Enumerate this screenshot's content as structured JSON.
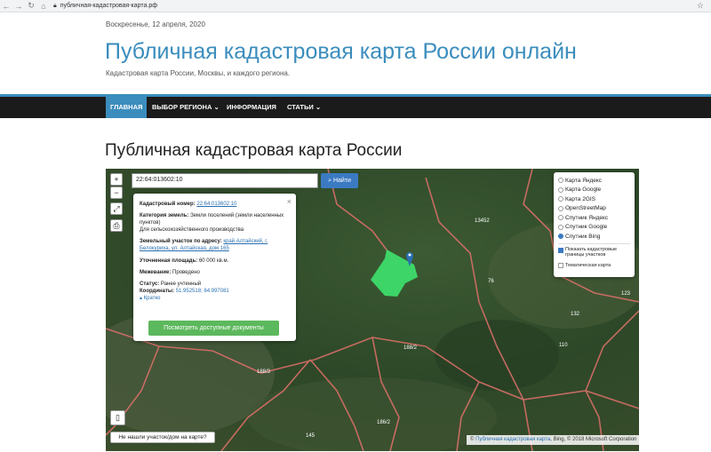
{
  "browser": {
    "url": "публичная-кадастровая-карта.рф"
  },
  "header": {
    "date": "Воскресенье, 12 апреля, 2020",
    "site_title": "Публичная кадастровая карта России онлайн",
    "site_desc": "Кадастровая карта России, Москвы, и каждого региона."
  },
  "nav": {
    "home": "ГЛАВНАЯ",
    "region": "ВЫБОР РЕГИОНА",
    "info": "ИНФОРМАЦИЯ",
    "articles": "СТАТЬИ"
  },
  "page": {
    "title": "Публичная кадастровая карта России"
  },
  "map": {
    "search_value": "22:64:013602:10",
    "find_label": "Найти",
    "popup": {
      "cad_label": "Кадастровый номер:",
      "cad_value": "22:64:013602:10",
      "cat_label": "Категория земель:",
      "cat_value": "Земли поселений (земли населенных пунктов)",
      "cat_extra": "Для сельскохозяйственного производства",
      "addr_label": "Земельный участок по адресу:",
      "addr_value": "край Алтайский, г. Белокуриха, ул. Алтайская, дом 165",
      "area_label": "Уточненная площадь:",
      "area_value": "60 000 кв.м.",
      "mezh_label": "Межевание:",
      "mezh_value": "Проведено",
      "status_label": "Статус:",
      "status_value": "Ранее учтенный",
      "coord_label": "Координаты:",
      "coord_value": "51.952518; 84.997081",
      "brief": "Кратко",
      "docs_button": "Посмотреть доступные документы"
    },
    "layers": [
      {
        "label": "Карта Яндекс",
        "selected": false
      },
      {
        "label": "Карта Google",
        "selected": false
      },
      {
        "label": "Карта 2GIS",
        "selected": false
      },
      {
        "label": "OpenStreetMap",
        "selected": false
      },
      {
        "label": "Спутник Яндекс",
        "selected": false
      },
      {
        "label": "Спутник Google",
        "selected": false
      },
      {
        "label": "Спутник Bing",
        "selected": true
      }
    ],
    "overlays": [
      {
        "label": "Показать кадастровые границы участков",
        "checked": true
      },
      {
        "label": "Тематическая карта",
        "checked": false
      }
    ],
    "notfound": "Не нашли участок/дом на карте?",
    "attribution_link": "Публичная кадастровая карта",
    "attribution_rest": ", Bing, © 2018 Microsoft Corporation",
    "parcel_labels": [
      "13452",
      "76",
      "188/2",
      "110",
      "132",
      "123",
      "188/3",
      "186/2",
      "145"
    ],
    "colors": {
      "boundary": "#e0706b",
      "parcel": "#3ddc6a",
      "accent": "#3b8dbd"
    }
  }
}
